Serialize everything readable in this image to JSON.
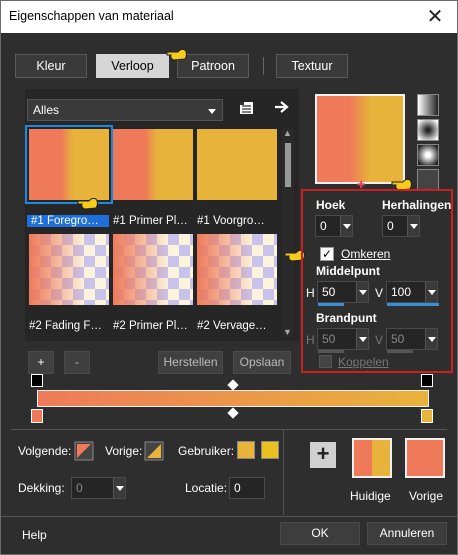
{
  "window": {
    "title": "Eigenschappen van materiaal",
    "close_icon": "close-icon"
  },
  "tabs": [
    {
      "label": "Kleur"
    },
    {
      "label": "Verloop"
    },
    {
      "label": "Patroon"
    },
    {
      "label": "Textuur"
    }
  ],
  "category": {
    "value": "Alles"
  },
  "gallery": [
    {
      "caption": "#1 Foregro…",
      "colors": [
        "#ee7a5a",
        "#e8b33a"
      ]
    },
    {
      "caption": "#1 Primer Pl…",
      "colors": [
        "#ee7a5a",
        "#e8b33a"
      ]
    },
    {
      "caption": "#1 Voorgro…",
      "colors": [
        "#e8b33a",
        "#e8b33a"
      ]
    },
    {
      "caption": "#2 Fading F…",
      "colors": [
        "#ee7a5a",
        "#f5e6c0"
      ]
    },
    {
      "caption": "#2 Primer Pl…",
      "colors": [
        "#ee7a5a",
        "#f5e6c0"
      ]
    },
    {
      "caption": "#2 Vervage…",
      "colors": [
        "#ee7a5a",
        "#f5e6c0"
      ]
    }
  ],
  "buttons": {
    "add": "+",
    "remove": "-",
    "restore": "Herstellen",
    "save": "Opslaan",
    "ok": "OK",
    "cancel": "Annuleren",
    "help": "Help",
    "plus": "+"
  },
  "settings": {
    "angle_label": "Hoek",
    "angle_value": "0",
    "repeats_label": "Herhalingen",
    "repeats_value": "0",
    "invert_label": "Omkeren",
    "invert_checked": true,
    "center_label": "Middelpunt",
    "center_h_label": "H",
    "center_h": "50",
    "center_v_label": "V",
    "center_v": "100",
    "focal_label": "Brandpunt",
    "focal_h_label": "H",
    "focal_h": "50",
    "focal_v_label": "V",
    "focal_v": "50",
    "link_label": "Koppelen"
  },
  "footer": {
    "next_label": "Volgende:",
    "prev_label": "Vorige:",
    "user_label": "Gebruiker:",
    "opacity_label": "Dekking:",
    "opacity_value": "0",
    "location_label": "Locatie:",
    "location_value": "0",
    "current_label": "Huidige",
    "previous_label": "Vorige",
    "user_colors": [
      "#e8b33a",
      "#e8c020"
    ]
  },
  "colors": {
    "salmon": "#ee7a5a",
    "gold": "#e8b33a",
    "accent": "#3a8fd8",
    "highlight_border": "#cc1f1f",
    "select_border": "#1e88e5"
  }
}
